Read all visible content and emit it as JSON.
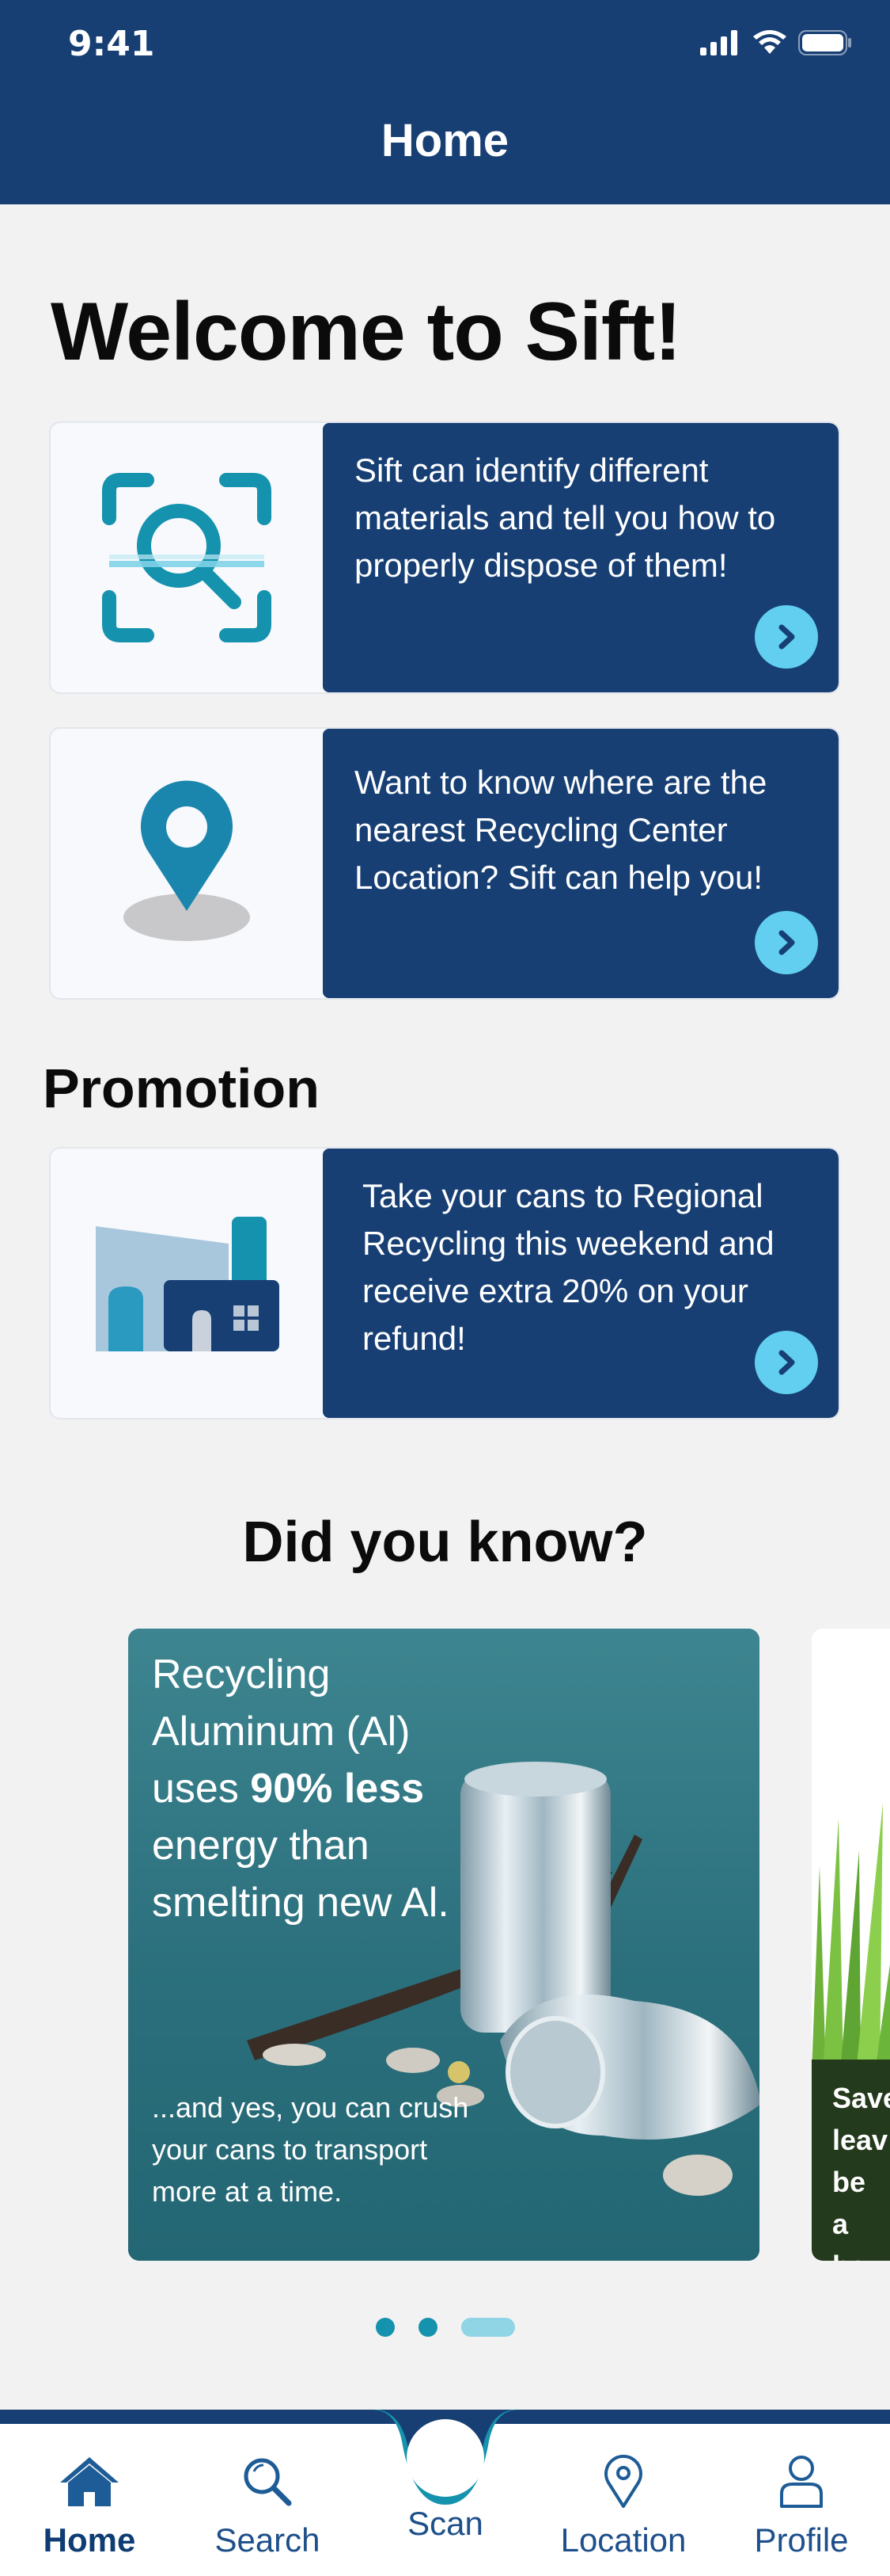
{
  "status": {
    "time": "9:41"
  },
  "header": {
    "title": "Home"
  },
  "welcome": {
    "title": "Welcome to Sift!"
  },
  "feature_cards": [
    {
      "icon": "scan-search-icon",
      "text": "Sift can identify different materials and tell you how to properly dispose of them!"
    },
    {
      "icon": "map-pin-icon",
      "text": "Want to know where are the nearest Recycling Center Location? Sift can help you!"
    }
  ],
  "promotion": {
    "title": "Promotion",
    "card": {
      "icon": "recycling-factory-icon",
      "text": "Take your cans to Regional Recycling this weekend and receive extra 20% on your refund!"
    }
  },
  "did_you_know": {
    "title": "Did you know?",
    "facts": [
      {
        "headline_before": "Recycling Aluminum (Al) uses ",
        "headline_bold": "90% less",
        "headline_after": " energy than smelting new Al.",
        "footnote": "...and yes, you can crush your cans to transport more at a time."
      },
      {
        "partial_text": "Save leav be a be u"
      }
    ],
    "pagination": {
      "count": 3,
      "active_index": 2
    }
  },
  "tab_bar": {
    "tabs": [
      {
        "id": "home",
        "label": "Home",
        "icon": "home-icon"
      },
      {
        "id": "search",
        "label": "Search",
        "icon": "search-icon"
      },
      {
        "id": "scan",
        "label": "Scan",
        "icon": "scan-button-icon"
      },
      {
        "id": "location",
        "label": "Location",
        "icon": "location-pin-icon"
      },
      {
        "id": "profile",
        "label": "Profile",
        "icon": "profile-icon"
      }
    ],
    "active": "home"
  },
  "colors": {
    "navy": "#173f74",
    "accent_cyan": "#62cff0",
    "icon_blue": "#1592ad",
    "background": "#f2f2f3"
  }
}
